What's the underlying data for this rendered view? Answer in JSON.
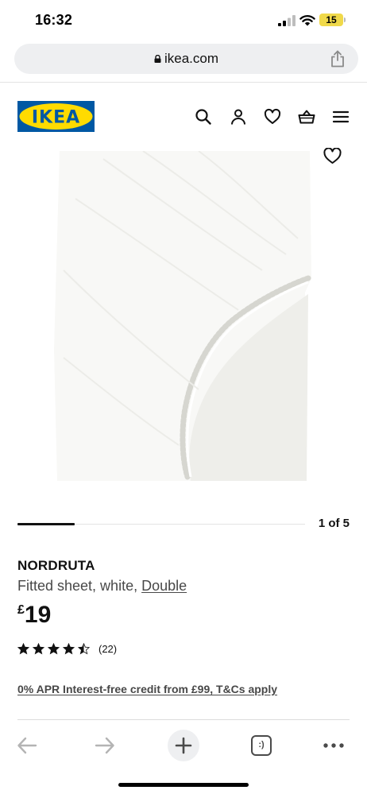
{
  "status_bar": {
    "time": "16:32",
    "battery": "15"
  },
  "browser": {
    "url": "ikea.com"
  },
  "site_header": {
    "logo_text": "IKEA",
    "icons": [
      "search-icon",
      "account-icon",
      "heart-icon",
      "basket-icon",
      "menu-icon"
    ]
  },
  "carousel": {
    "counter": "1 of 5",
    "current": 1,
    "total": 5
  },
  "product": {
    "name": "NORDRUTA",
    "description_prefix": "Fitted sheet, white, ",
    "size": "Double",
    "currency": "£",
    "price": "19",
    "rating": 4.5,
    "rating_max": 5,
    "review_count": "(22)",
    "credit_offer": "0% APR Interest-free credit from £99, T&Cs apply"
  },
  "colors": {
    "brand_blue": "#0058a3",
    "brand_yellow": "#ffdb00",
    "text_primary": "#111111",
    "text_secondary": "#484848",
    "battery_yellow": "#f0d94a"
  },
  "toolbar": {
    "tabs_label": ":)",
    "icons": [
      "back-arrow-icon",
      "forward-arrow-icon",
      "plus-icon",
      "tabs-icon",
      "more-icon"
    ]
  }
}
